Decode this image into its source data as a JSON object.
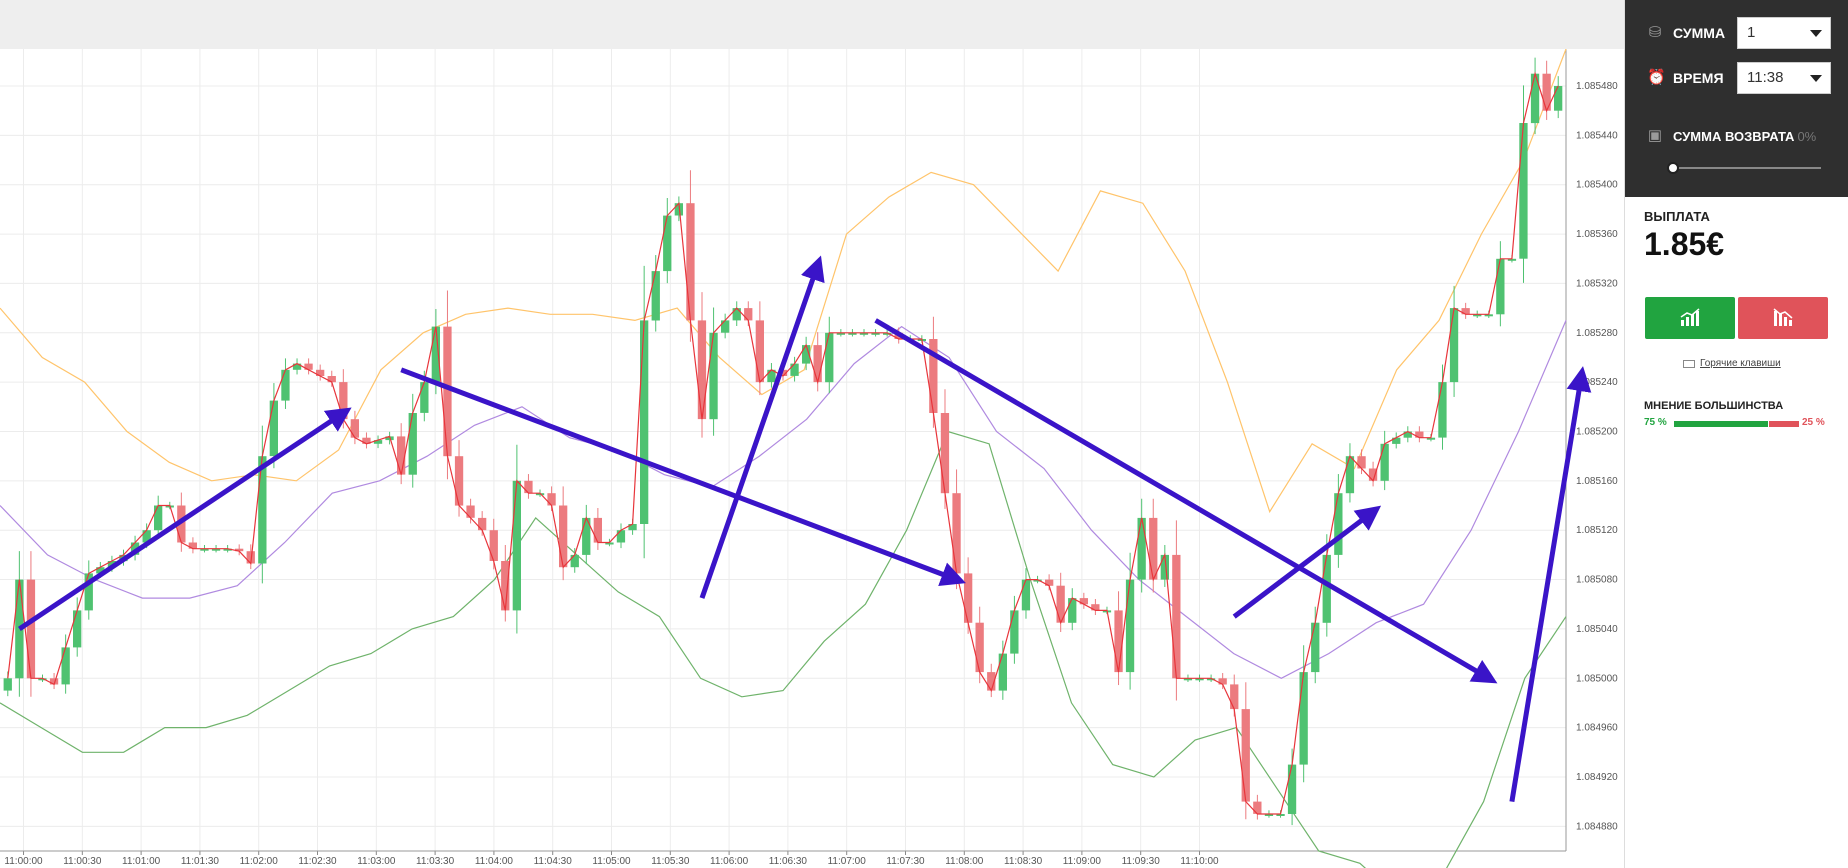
{
  "panel": {
    "amount_label": "СУММА",
    "amount_value": "1",
    "time_label": "ВРЕМЯ",
    "time_value": "11:38",
    "refund_label": "СУММА ВОЗВРАТА",
    "refund_pct": "0%",
    "payout_label": "ВЫПЛАТА",
    "payout_value": "1.85€",
    "hotkeys_label": "Горячие клавиши",
    "majority_label": "МНЕНИЕ БОЛЬШИНСТВА",
    "majority_up": "75 %",
    "majority_down": "25 %",
    "majority_up_fraction": 0.75,
    "icons": [
      "coins-icon",
      "alarm-clock-icon",
      "safe-icon",
      "chart-up-icon",
      "chart-down-icon",
      "keyboard-icon"
    ]
  },
  "colors": {
    "up": "#21a440",
    "down": "#e0535a",
    "up_candle": "#4fc271",
    "down_candle": "#ec7b7f",
    "price_line": "#e8353b",
    "upper_band": "#ffc46b",
    "middle_band": "#b08ae0",
    "lower_band": "#6fb36b",
    "arrow": "#3a14c8"
  },
  "chart_data": {
    "type": "candlestick",
    "x_tick_labels": [
      "11:00:00",
      "11:00:30",
      "11:01:00",
      "11:01:30",
      "11:02:00",
      "11:02:30",
      "11:03:00",
      "11:03:30",
      "11:04:00",
      "11:04:30",
      "11:05:00",
      "11:05:30",
      "11:06:00",
      "11:06:30",
      "11:07:00",
      "11:07:30",
      "11:08:00",
      "11:08:30",
      "11:09:00",
      "11:09:30",
      "11:10:00"
    ],
    "y_tick_labels": [
      "1.085480",
      "1.085440",
      "1.085400",
      "1.085360",
      "1.085320",
      "1.085280",
      "1.085240",
      "1.085200",
      "1.085160",
      "1.085120",
      "1.085080",
      "1.085040",
      "1.085000",
      "1.084960",
      "1.084920",
      "1.084880"
    ],
    "ylim": [
      1.08486,
      1.08551
    ],
    "xlim_seconds_after_11_00": [
      -12,
      787
    ],
    "grid": true,
    "close": [
      1.085,
      1.08508,
      1.085,
      1.085,
      1.084995,
      1.085025,
      1.085055,
      1.085085,
      1.08509,
      1.085095,
      1.0851,
      1.08511,
      1.08512,
      1.08514,
      1.08514,
      1.08511,
      1.085105,
      1.085105,
      1.085105,
      1.085105,
      1.085103,
      1.085093,
      1.08518,
      1.085225,
      1.08525,
      1.085255,
      1.08525,
      1.085245,
      1.08524,
      1.08521,
      1.085195,
      1.08519,
      1.085193,
      1.085196,
      1.085165,
      1.085215,
      1.08524,
      1.085285,
      1.08518,
      1.08514,
      1.08513,
      1.08512,
      1.085095,
      1.085055,
      1.08516,
      1.08515,
      1.08515,
      1.08514,
      1.08509,
      1.0851,
      1.08513,
      1.08511,
      1.08511,
      1.08512,
      1.085125,
      1.08529,
      1.08533,
      1.085375,
      1.085385,
      1.08529,
      1.08521,
      1.08528,
      1.08529,
      1.0853,
      1.08529,
      1.08524,
      1.08525,
      1.085245,
      1.085255,
      1.08527,
      1.08524,
      1.08528,
      1.08528,
      1.08528,
      1.08528,
      1.08528,
      1.08528,
      1.085275,
      1.085275,
      1.085275,
      1.085215,
      1.08515,
      1.085085,
      1.085045,
      1.085005,
      1.08499,
      1.08502,
      1.085055,
      1.08508,
      1.08508,
      1.085075,
      1.085045,
      1.085065,
      1.08506,
      1.085055,
      1.085055,
      1.085005,
      1.08508,
      1.08513,
      1.08508,
      1.0851,
      1.085,
      1.085,
      1.085,
      1.085,
      1.084995,
      1.084975,
      1.0849,
      1.08489,
      1.08489,
      1.08489,
      1.08493,
      1.085005,
      1.085045,
      1.0851,
      1.08515,
      1.08518,
      1.08517,
      1.08516,
      1.08519,
      1.085195,
      1.0852,
      1.085195,
      1.085195,
      1.08524,
      1.0853,
      1.085295,
      1.085295,
      1.085295,
      1.08534,
      1.08534,
      1.08545,
      1.08549,
      1.08546,
      1.08548
    ],
    "upper_band": [
      1.0853,
      1.08526,
      1.08524,
      1.0852,
      1.085175,
      1.08516,
      1.085165,
      1.08516,
      1.085185,
      1.08525,
      1.08528,
      1.085295,
      1.0853,
      1.085295,
      1.085295,
      1.08529,
      1.0853,
      1.08526,
      1.08523,
      1.08525,
      1.08536,
      1.08539,
      1.08541,
      1.0854,
      1.085365,
      1.08533,
      1.085395,
      1.085385,
      1.08533,
      1.08524,
      1.085135,
      1.08519,
      1.08517,
      1.08525,
      1.08529,
      1.08536,
      1.08542,
      1.08551
    ],
    "middle_band": [
      1.08514,
      1.0851,
      1.08508,
      1.085065,
      1.085065,
      1.085075,
      1.08511,
      1.08515,
      1.08516,
      1.08518,
      1.085205,
      1.08522,
      1.085195,
      1.085185,
      1.085165,
      1.085155,
      1.08518,
      1.08521,
      1.085255,
      1.085285,
      1.08526,
      1.0852,
      1.08517,
      1.08512,
      1.08508,
      1.08505,
      1.08502,
      1.085,
      1.08502,
      1.085045,
      1.08506,
      1.08512,
      1.0852,
      1.08529
    ],
    "lower_band": [
      1.08498,
      1.08496,
      1.08494,
      1.08494,
      1.08496,
      1.08496,
      1.08497,
      1.08499,
      1.08501,
      1.08502,
      1.08504,
      1.08505,
      1.08508,
      1.08513,
      1.0851,
      1.08507,
      1.08505,
      1.085,
      1.084985,
      1.08499,
      1.08503,
      1.08506,
      1.08512,
      1.0852,
      1.08519,
      1.08508,
      1.08498,
      1.08493,
      1.08492,
      1.08495,
      1.08496,
      1.08491,
      1.08486,
      1.08485,
      1.08482,
      1.08484,
      1.0849,
      1.085,
      1.08505
    ]
  }
}
